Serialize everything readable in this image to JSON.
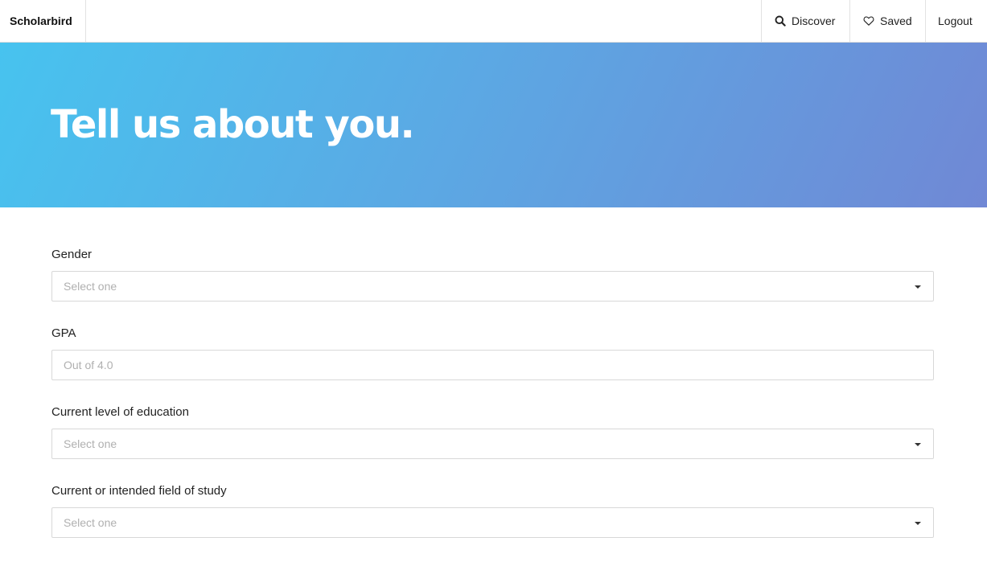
{
  "nav": {
    "brand": "Scholarbird",
    "discover_label": "Discover",
    "saved_label": "Saved",
    "logout_label": "Logout",
    "discover_icon": "search-icon",
    "saved_icon": "heart-icon"
  },
  "hero": {
    "title": "Tell us about you.",
    "gradient_start": "#47c3ef",
    "gradient_end": "#7088d5"
  },
  "form": {
    "gender": {
      "label": "Gender",
      "placeholder": "Select one"
    },
    "gpa": {
      "label": "GPA",
      "placeholder": "Out of 4.0"
    },
    "education": {
      "label": "Current level of education",
      "placeholder": "Select one"
    },
    "field_of_study": {
      "label": "Current or intended field of study",
      "placeholder": "Select one"
    }
  }
}
